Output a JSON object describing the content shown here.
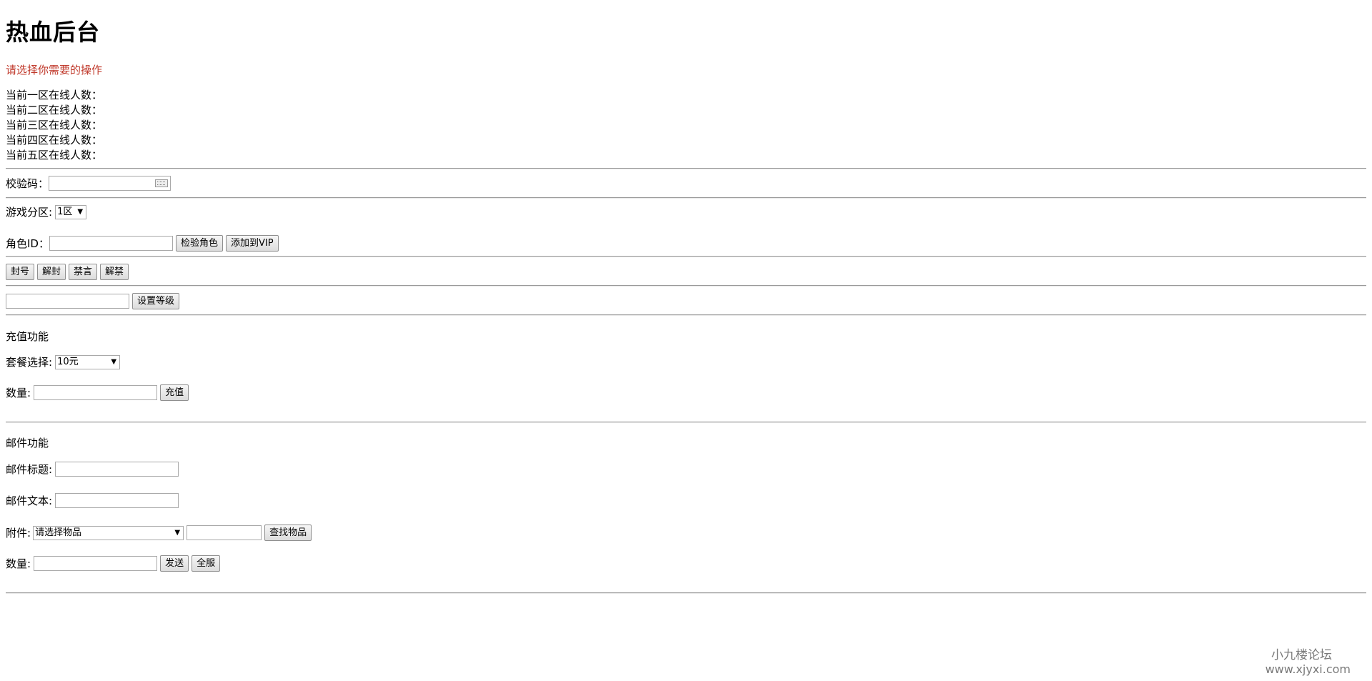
{
  "header": {
    "title": "热血后台",
    "hint": "请选择你需要的操作"
  },
  "online": [
    "当前一区在线人数：",
    "当前二区在线人数：",
    "当前三区在线人数：",
    "当前四区在线人数：",
    "当前五区在线人数："
  ],
  "verify": {
    "label": "校验码：",
    "value": ""
  },
  "zone": {
    "label": "游戏分区:",
    "selected": "1区"
  },
  "role": {
    "label": "角色ID：",
    "value": "",
    "check_button": "检验角色",
    "vip_button": "添加到VIP"
  },
  "actions": {
    "ban": "封号",
    "unban": "解封",
    "mute": "禁言",
    "unmute": "解禁"
  },
  "level": {
    "value": "",
    "button": "设置等级"
  },
  "recharge": {
    "section_title": "充值功能",
    "package_label": "套餐选择:",
    "package_selected": "10元",
    "qty_label": "数量:",
    "qty_value": "",
    "button": "充值"
  },
  "mail": {
    "section_title": "邮件功能",
    "subject_label": "邮件标题:",
    "subject_value": "",
    "body_label": "邮件文本:",
    "body_value": "",
    "attach_label": "附件:",
    "attach_selected": "请选择物品",
    "search_value": "",
    "search_button": "查找物品",
    "qty_label": "数量:",
    "qty_value": "",
    "send_button": "发送",
    "all_button": "全服"
  },
  "watermark": {
    "line1": "小九楼论坛",
    "line2": "www.xjyxi.com"
  }
}
